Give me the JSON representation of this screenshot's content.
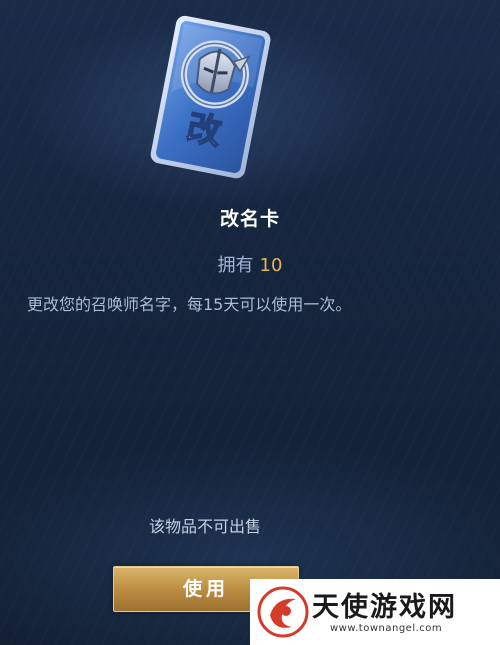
{
  "item": {
    "icon_char": "改",
    "name": "改名卡",
    "own_label": "拥有",
    "own_count": "10",
    "description": "更改您的召唤师名字，每15天可以使用一次。",
    "sell_note": "该物品不可出售",
    "use_label": "使用"
  },
  "watermark": {
    "brand": "天使游戏网",
    "url": "www.townangel.com"
  },
  "colors": {
    "accent_gold": "#e2b653",
    "button_gold": "#c79a4c",
    "background": "#17263f"
  }
}
